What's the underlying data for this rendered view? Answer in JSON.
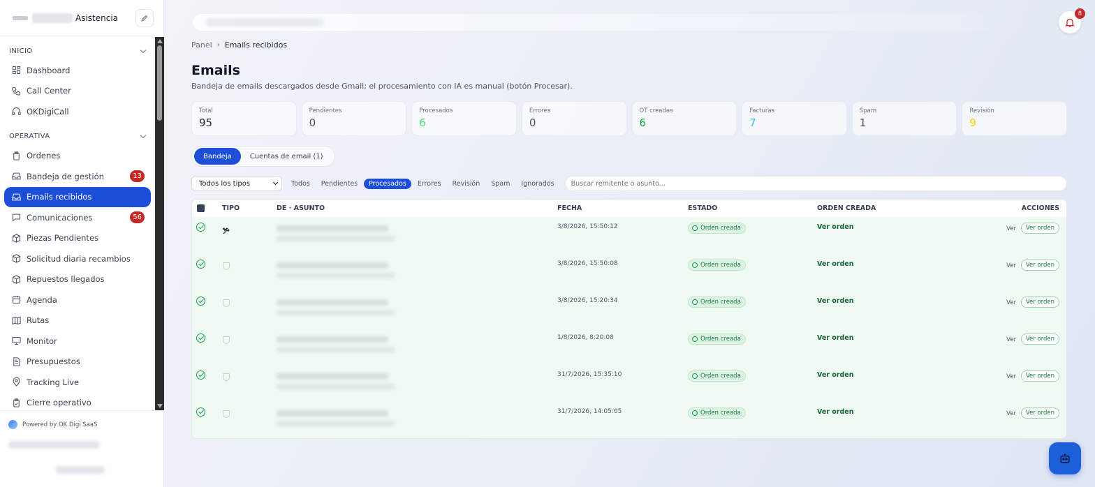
{
  "brand": {
    "name": "Asistencia"
  },
  "sidebar": {
    "sections": [
      {
        "title": "INICIO",
        "items": [
          {
            "label": "Dashboard",
            "icon": "dashboard-icon"
          },
          {
            "label": "Call Center",
            "icon": "phone-icon"
          },
          {
            "label": "OKDigiCall",
            "icon": "headset-icon"
          }
        ]
      },
      {
        "title": "OPERATIVA",
        "items": [
          {
            "label": "Ordenes",
            "icon": "clipboard-icon"
          },
          {
            "label": "Bandeja de gestión",
            "icon": "inbox-icon",
            "badge": "13"
          },
          {
            "label": "Emails recibidos",
            "icon": "inbox-icon",
            "active": true
          },
          {
            "label": "Comunicaciones",
            "icon": "message-icon",
            "badge": "56"
          },
          {
            "label": "Piezas Pendientes",
            "icon": "package-icon"
          },
          {
            "label": "Solicitud diaria recambios",
            "icon": "package-icon"
          },
          {
            "label": "Repuestos llegados",
            "icon": "package-icon"
          },
          {
            "label": "Agenda",
            "icon": "calendar-icon"
          },
          {
            "label": "Rutas",
            "icon": "map-icon"
          },
          {
            "label": "Monitor",
            "icon": "monitor-icon"
          },
          {
            "label": "Presupuestos",
            "icon": "document-icon"
          },
          {
            "label": "Tracking Live",
            "icon": "location-pin-icon"
          },
          {
            "label": "Cierre operativo",
            "icon": "clipboard-check-icon"
          }
        ]
      }
    ],
    "powered": "Powered by OK Digi SaaS"
  },
  "header": {
    "notifications_count": "8"
  },
  "breadcrumb": {
    "root": "Panel",
    "current": "Emails recibidos"
  },
  "page": {
    "title": "Emails",
    "subtitle": "Bandeja de emails descargados desde Gmail; el procesamiento con IA es manual (botón Procesar)."
  },
  "stats": [
    {
      "label": "Total",
      "value": "95",
      "color": "#1f2937"
    },
    {
      "label": "Pendientes",
      "value": "0",
      "color": "#4b5563"
    },
    {
      "label": "Procesados",
      "value": "6",
      "color": "#4ade80"
    },
    {
      "label": "Errores",
      "value": "0",
      "color": "#4b5563"
    },
    {
      "label": "OT creadas",
      "value": "6",
      "color": "#16a34a"
    },
    {
      "label": "Facturas",
      "value": "7",
      "color": "#38bdf8"
    },
    {
      "label": "Spam",
      "value": "1",
      "color": "#4b5563"
    },
    {
      "label": "Revisión",
      "value": "9",
      "color": "#facc15"
    }
  ],
  "tabs": [
    {
      "label": "Bandeja",
      "active": true
    },
    {
      "label": "Cuentas de email (1)",
      "active": false
    }
  ],
  "filters": {
    "type_select": "Todos los tipos",
    "chips": [
      {
        "label": "Todos"
      },
      {
        "label": "Pendientes"
      },
      {
        "label": "Procesados",
        "active": true
      },
      {
        "label": "Errores"
      },
      {
        "label": "Revisión"
      },
      {
        "label": "Spam"
      },
      {
        "label": "Ignorados"
      }
    ],
    "search_placeholder": "Buscar remitente o asunto..."
  },
  "table": {
    "headers": {
      "tipo": "TIPO",
      "de_asunto": "DE · ASUNTO",
      "fecha": "FECHA",
      "estado": "ESTADO",
      "orden": "ORDEN CREADA",
      "acciones": "ACCIONES"
    },
    "rows": [
      {
        "type_icon": "tools-icon",
        "fecha": "3/8/2026, 15:50:12",
        "estado": "Orden creada",
        "orden": "Ver orden",
        "ver": "Ver",
        "ver_orden": "Ver orden"
      },
      {
        "type_icon": "shield-icon",
        "fecha": "3/8/2026, 15:50:08",
        "estado": "Orden creada",
        "orden": "Ver orden",
        "ver": "Ver",
        "ver_orden": "Ver orden"
      },
      {
        "type_icon": "shield-icon",
        "fecha": "3/8/2026, 15:20:34",
        "estado": "Orden creada",
        "orden": "Ver orden",
        "ver": "Ver",
        "ver_orden": "Ver orden"
      },
      {
        "type_icon": "shield-icon",
        "fecha": "1/8/2026, 8:20:08",
        "estado": "Orden creada",
        "orden": "Ver orden",
        "ver": "Ver",
        "ver_orden": "Ver orden"
      },
      {
        "type_icon": "shield-icon",
        "fecha": "31/7/2026, 15:35:10",
        "estado": "Orden creada",
        "orden": "Ver orden",
        "ver": "Ver",
        "ver_orden": "Ver orden"
      },
      {
        "type_icon": "shield-icon",
        "fecha": "31/7/2026, 14:05:05",
        "estado": "Orden creada",
        "orden": "Ver orden",
        "ver": "Ver",
        "ver_orden": "Ver orden"
      }
    ]
  }
}
